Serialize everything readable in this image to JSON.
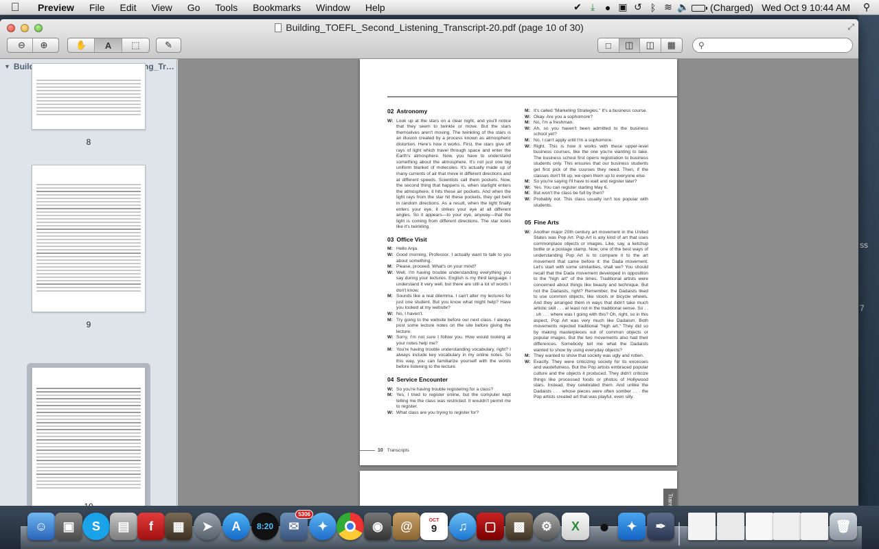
{
  "menubar": {
    "app_name": "Preview",
    "items": [
      "File",
      "Edit",
      "View",
      "Go",
      "Tools",
      "Bookmarks",
      "Window",
      "Help"
    ],
    "battery_status": "(Charged)",
    "datetime": "Wed Oct 9  10:44 AM"
  },
  "window": {
    "title": "Building_TOEFL_Second_Listening_Transcript-20.pdf (page 10 of 30)",
    "search_placeholder": ""
  },
  "sidebar": {
    "title": "Building_TOEFL_Second_Listening_Tr…",
    "pages": [
      {
        "label": "8"
      },
      {
        "label": "9"
      },
      {
        "label": "10"
      }
    ],
    "selected_page": "10"
  },
  "document": {
    "footer_page_number": "10",
    "footer_label": "Transcripts",
    "next_page_tab": "Trans",
    "sections": {
      "s02": {
        "number": "02",
        "title": "Astronomy"
      },
      "s03": {
        "number": "03",
        "title": "Office Visit"
      },
      "s04": {
        "number": "04",
        "title": "Service Encounter"
      },
      "s05": {
        "number": "05",
        "title": "Fine Arts"
      }
    },
    "astronomy": [
      {
        "speaker": "W:",
        "text": "Look up at the stars on a clear night, and you'll notice that they seem to twinkle or move. But the stars themselves aren't moving. The twinkling of the stars is an illusion created by a process known as atmospheric distortion. Here's how it works. First, the stars give off rays of light which travel through space and enter the Earth's atmosphere. Now, you have to understand something about the atmosphere. It's not just one big uniform blanket of molecules. It's actually made up of many currents of air that move in different directions and at different speeds. Scientists call them pockets. Now, the second thing that happens is, when starlight enters the atmosphere, it hits these air pockets. And when the light rays from the star hit these pockets, they get bent in random directions. As a result, when the light finally enters your eye, it strikes your eye at all different angles. So it appears—to your eye, anyway—that the light is coming from different directions. The star looks like it's twinkling."
      }
    ],
    "office_visit": [
      {
        "speaker": "M:",
        "text": "Hello Anja."
      },
      {
        "speaker": "W:",
        "text": "Good morning, Professor. I actually want to talk to you about something."
      },
      {
        "speaker": "M:",
        "text": "Please, proceed. What's on your mind?"
      },
      {
        "speaker": "W:",
        "text": "Well, I'm having trouble understanding everything you say during your lectures. English is my third language. I understand it very well, but there are still a lot of words I don't know."
      },
      {
        "speaker": "M:",
        "text": "Sounds like a real dilemma. I can't alter my lectures for just one student. But you know what might help? Have you looked at my website?"
      },
      {
        "speaker": "W:",
        "text": "No, I haven't."
      },
      {
        "speaker": "M:",
        "text": "Try going to the website before our next class. I always post some lecture notes on the site before giving the lecture."
      },
      {
        "speaker": "W:",
        "text": "Sorry, I'm not sure I follow you. How would looking at your notes help me?"
      },
      {
        "speaker": "M:",
        "text": "You're having trouble understanding vocabulary, right? I always include key vocabulary in my online notes. So this way, you can familiarize yourself with the words before listening to the lecture."
      }
    ],
    "service_encounter": [
      {
        "speaker": "W:",
        "text": "So you're having trouble registering for a class?"
      },
      {
        "speaker": "M:",
        "text": "Yes, I tried to register online, but the computer kept telling me the class was restricted. It wouldn't permit me to register."
      },
      {
        "speaker": "W:",
        "text": "What class are you trying to register for?"
      }
    ],
    "service_encounter_cont": [
      {
        "speaker": "M:",
        "text": "It's called \"Marketing Strategies.\" It's a business course."
      },
      {
        "speaker": "W:",
        "text": "Okay. Are you a sophomore?"
      },
      {
        "speaker": "M:",
        "text": "No, I'm a freshman."
      },
      {
        "speaker": "W:",
        "text": "Ah, so you haven't been admitted to the business school yet?"
      },
      {
        "speaker": "M:",
        "text": "No, I can't apply until I'm a sophomore."
      },
      {
        "speaker": "W:",
        "text": "Right. This is how it works with these upper-level business courses, like the one you're wanting to take. The business school first opens registration to business students only. This ensures that our business students get first pick of the courses they need. Then, if the classes don't fill up, we open them up to everyone else."
      },
      {
        "speaker": "M:",
        "text": "So you're saying I'll have to wait and register later?"
      },
      {
        "speaker": "W:",
        "text": "Yes. You can register starting May 6."
      },
      {
        "speaker": "M:",
        "text": "But won't the class be full by then?"
      },
      {
        "speaker": "W:",
        "text": "Probably not. This class usually isn't too popular with students."
      }
    ],
    "fine_arts": [
      {
        "speaker": "W:",
        "text": "Another major 20th century art movement in the United States was Pop Art. Pop Art is any kind of art that uses commonplace objects or images. Like, say, a ketchup bottle or a postage stamp. Now, one of the best ways of understanding Pop Art is to compare it to the art movement that came before it: the Dada movement. Let's start with some similarities, shall we? You should recall that the Dada movement developed in opposition to the \"high art\" of the times. Traditional artists were concerned about things like beauty and technique. But not the Dadaists, right? Remember, the Dadaists liked to use common objects, like stools or bicycle wheels. And they arranged them in ways that didn't take much artistic skill . . . at least not in the traditional sense. So . . . uh . . . where was I going with this? Oh, right, so in this aspect, Pop Art was very much like Dadaism. Both movements rejected traditional \"high art.\" They did so by making masterpieces out of common objects or popular images. But the two movements also had their differences. Somebody tell me what the Dadaists wanted to show by using everyday objects?"
      },
      {
        "speaker": "M:",
        "text": "They wanted to show that society was ugly and rotten."
      },
      {
        "speaker": "W:",
        "text": "Exactly. They were criticizing society for its excesses and wastefulness. But the Pop artists embraced popular culture and the objects it produced. They didn't criticize things like processed foods or photos of Hollywood stars. Instead, they celebrated them. And unlike the Dadaists . . . whose pieces were often somber . . . the Pop artists created art that was playful, even silly."
      }
    ]
  },
  "dock": {
    "mail_badge": "5306",
    "calendar_day": "9",
    "calendar_month": "OCT"
  },
  "colors": {
    "highlight": "#dcdcdc",
    "viewer_bg": "#8d8d8d",
    "sidebar_bg": "#dfe4ea"
  }
}
